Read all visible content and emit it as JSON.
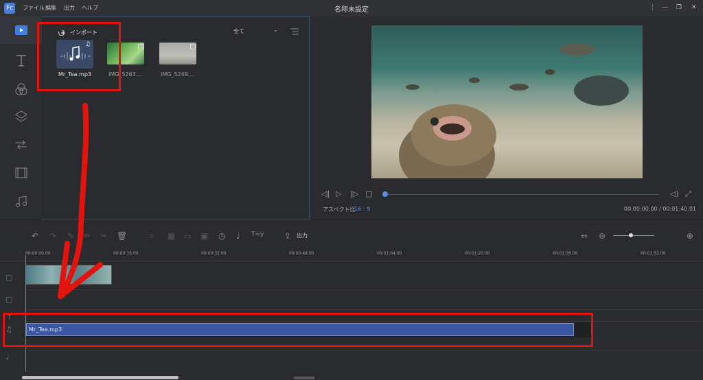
{
  "app": {
    "title": "名称未設定",
    "logo_text": "Fc"
  },
  "menu": [
    "ファイル",
    "編集",
    "出力",
    "ヘルプ"
  ],
  "window_controls": {
    "more": "⋮",
    "minimize": "—",
    "restore": "❐",
    "close": "✕"
  },
  "sidebar": {
    "items": [
      {
        "name": "media",
        "icon": "play-icon"
      },
      {
        "name": "text",
        "icon": "text-icon"
      },
      {
        "name": "filters",
        "icon": "filters-icon"
      },
      {
        "name": "overlays",
        "icon": "layers-icon"
      },
      {
        "name": "transitions",
        "icon": "transition-icon"
      },
      {
        "name": "elements",
        "icon": "film-icon"
      },
      {
        "name": "music",
        "icon": "music-icon"
      }
    ]
  },
  "media_panel": {
    "import_label": "インポート",
    "filter_value": "全て",
    "items": [
      {
        "label": "Mr_Tea.mp3",
        "type": "audio"
      },
      {
        "label": "IMG_5263....",
        "type": "video"
      },
      {
        "label": "IMG_5249....",
        "type": "video"
      }
    ]
  },
  "preview": {
    "aspect_label": "アスペクト比",
    "aspect_value": "16 : 9",
    "timecode": "00:00:00.00 / 00:01:40.01",
    "playhead_progress": 0
  },
  "timeline": {
    "export_label": "出力",
    "ruler_ticks": [
      "00:00:00.00",
      "00:00:16.00",
      "00:00:32.00",
      "00:00:48.00",
      "00:01:04.00",
      "00:01:20.00",
      "00:01:36.00",
      "00:01:52.00"
    ],
    "audio_clip_label": "Mr_Tea.mp3"
  },
  "colors": {
    "accent": "#5a8de0",
    "annotation": "#e3140d",
    "audio_clip": "#3b55a0"
  }
}
